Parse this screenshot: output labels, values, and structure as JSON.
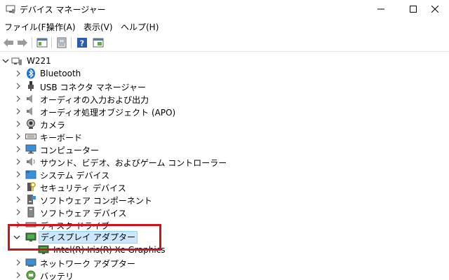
{
  "window": {
    "title": "デバイス マネージャー",
    "controls": [
      "minimize-icon",
      "maximize-icon",
      "close-icon"
    ]
  },
  "menu": [
    {
      "label": "ファイル(F)"
    },
    {
      "label": "操作(A)"
    },
    {
      "label": "表示(V)"
    },
    {
      "label": "ヘルプ(H)"
    }
  ],
  "toolbar": {
    "buttons": [
      "back-arrow-icon",
      "forward-arrow-icon",
      "properties-icon",
      "update-driver-icon",
      "help-icon",
      "scan-hardware-icon"
    ]
  },
  "tree": {
    "root": {
      "label": "W221",
      "expanded": true
    },
    "items": [
      {
        "label": "Bluetooth",
        "icon": "bluetooth-icon"
      },
      {
        "label": "USB コネクタ マネージャー",
        "icon": "usb-icon"
      },
      {
        "label": "オーディオの入力および出力",
        "icon": "speaker-icon"
      },
      {
        "label": "オーディオ処理オブジェクト (APO)",
        "icon": "speaker-icon"
      },
      {
        "label": "カメラ",
        "icon": "camera-icon"
      },
      {
        "label": "キーボード",
        "icon": "keyboard-icon"
      },
      {
        "label": "コンピューター",
        "icon": "computer-icon"
      },
      {
        "label": "サウンド、ビデオ、およびゲーム コントローラー",
        "icon": "sound-icon"
      },
      {
        "label": "システム デバイス",
        "icon": "system-folder-icon"
      },
      {
        "label": "セキュリティ デバイス",
        "icon": "security-key-icon"
      },
      {
        "label": "ソフトウェア コンポーネント",
        "icon": "software-component-icon"
      },
      {
        "label": "ソフトウェア デバイス",
        "icon": "software-device-icon"
      },
      {
        "label": "ディスク ドライブ",
        "icon": "disk-drive-icon"
      },
      {
        "label": "ディスプレイ アダプター",
        "icon": "display-adapter-icon",
        "expanded": true,
        "selected": true
      },
      {
        "label": "ネットワーク アダプター",
        "icon": "network-adapter-icon"
      },
      {
        "label": "バッテリ",
        "icon": "battery-icon"
      }
    ],
    "display_child": {
      "label": "Intel(R) Iris(R) Xe Graphics",
      "icon": "display-adapter-icon"
    }
  },
  "colors": {
    "highlight_box": "#d0121b",
    "selection_bg": "#cce8ff",
    "icon_blue": "#1a73c9"
  }
}
